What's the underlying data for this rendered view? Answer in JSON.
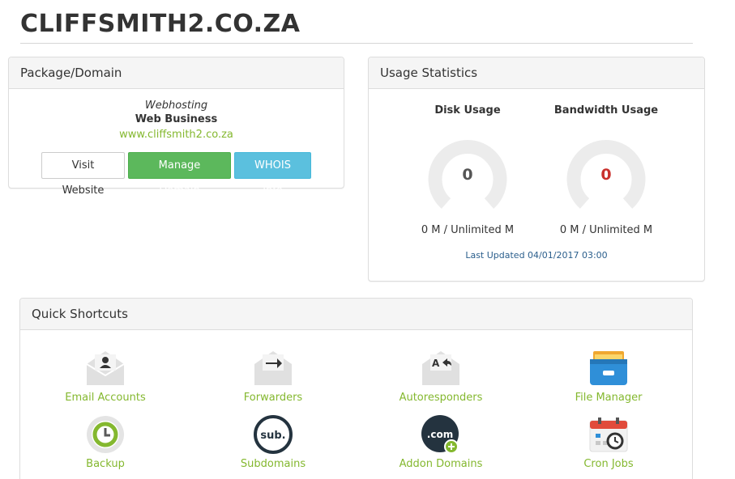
{
  "site": {
    "title": "CLIFFSMITH2.CO.ZA"
  },
  "package_panel": {
    "heading": "Package/Domain",
    "package_type": "Webhosting",
    "package_name": "Web Business",
    "domain": "www.cliffsmith2.co.za",
    "buttons": {
      "visit": "Visit Website",
      "manage": "Manage Domain",
      "whois": "WHOIS Info"
    }
  },
  "usage_panel": {
    "heading": "Usage Statistics",
    "disk": {
      "label": "Disk Usage",
      "value": "0",
      "stat": "0 M / Unlimited M",
      "value_color": "#555555"
    },
    "bandwidth": {
      "label": "Bandwidth Usage",
      "value": "0",
      "stat": "0 M / Unlimited M",
      "value_color": "#c9302c"
    },
    "last_updated": "Last Updated 04/01/2017 03:00"
  },
  "shortcuts": {
    "heading": "Quick Shortcuts",
    "items": [
      {
        "label": "Email Accounts",
        "icon": "email-accounts-icon"
      },
      {
        "label": "Forwarders",
        "icon": "forwarders-icon"
      },
      {
        "label": "Autoresponders",
        "icon": "autoresponders-icon"
      },
      {
        "label": "File Manager",
        "icon": "file-manager-icon"
      },
      {
        "label": "Backup",
        "icon": "backup-icon"
      },
      {
        "label": "Subdomains",
        "icon": "subdomains-icon"
      },
      {
        "label": "Addon Domains",
        "icon": "addon-domains-icon"
      },
      {
        "label": "Cron Jobs",
        "icon": "cron-jobs-icon"
      }
    ],
    "icon_text": {
      "subdomains": "sub.",
      "addon": ".com"
    }
  },
  "colors": {
    "link_green": "#84b82f",
    "success": "#5cb85c",
    "info": "#5bc0de"
  }
}
